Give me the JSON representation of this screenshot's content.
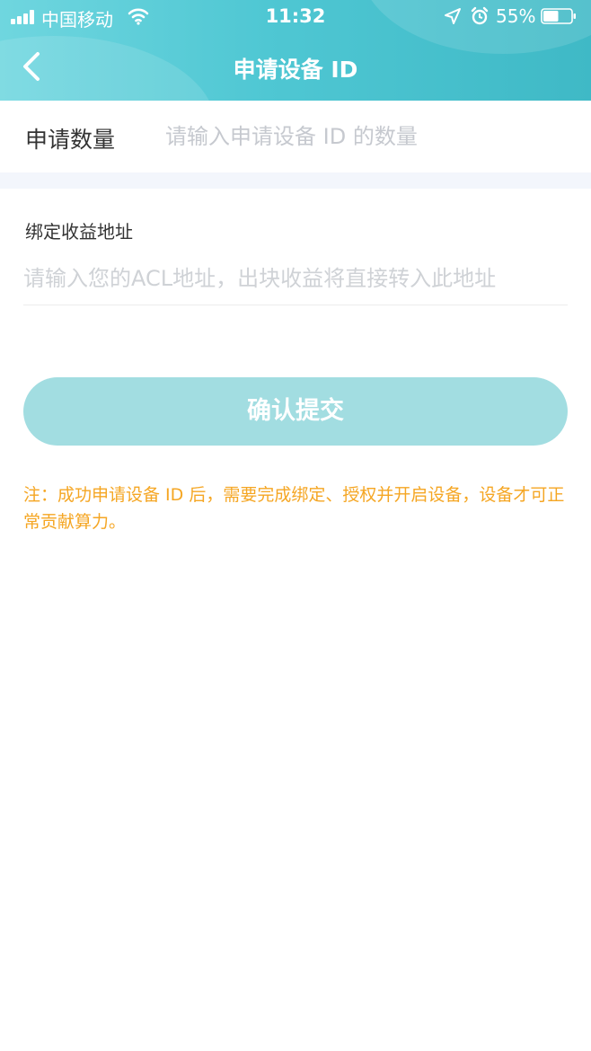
{
  "status_bar": {
    "carrier": "中国移动",
    "time": "11:32",
    "battery": "55%",
    "battery_level": 0.55,
    "icons": [
      "signal-icon",
      "wifi-icon",
      "location-icon",
      "alarm-icon",
      "battery-icon"
    ]
  },
  "header": {
    "title": "申请设备 ID",
    "back_icon": "chevron-left-icon"
  },
  "form": {
    "quantity_label": "申请数量",
    "quantity_placeholder": "请输入申请设备 ID 的数量",
    "address_label": "绑定收益地址",
    "address_placeholder": "请输入您的ACL地址，出块收益将直接转入此地址",
    "submit_label": "确认提交"
  },
  "note": "注：成功申请设备 ID 后，需要完成绑定、授权并开启设备，设备才可正常贡献算力。",
  "colors": {
    "header_gradient_start": "#6fd6df",
    "header_gradient_end": "#3fb9c6",
    "button": "#a2dde1",
    "note_text": "#f5a623",
    "section_gap": "#f3f6fc"
  }
}
